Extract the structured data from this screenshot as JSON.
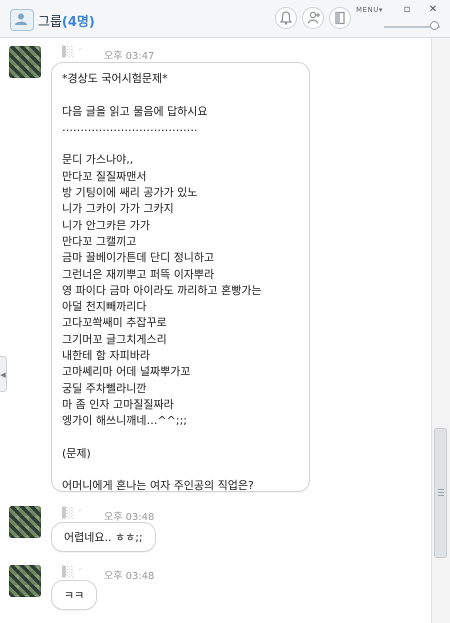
{
  "header": {
    "title": "그룹",
    "member_count": "(4명)",
    "menu_label": "MENU▾",
    "minimize_glyph": "▫",
    "close_glyph": "✕",
    "icons": [
      "group-icon",
      "bell-icon",
      "add-person-icon",
      "door-exit-icon"
    ]
  },
  "messages": [
    {
      "sender": "▐░ ’",
      "time": "오후 03:47",
      "lines": [
        "*경상도 국어시험문제*",
        "",
        "다음 글을 읽고 물음에 답하시요",
        "……………………………….",
        "",
        "문디 가스나야,,",
        "만다꼬 질질짜맨서",
        "방 기팅이에 쌔리 공가가 있노",
        "니가 그카이 가가 그카지",
        "니가 안그카믄 가가",
        "만다꼬 그캘끼고",
        "금마 끌베이가튼데 단디 정니하고",
        "그런너은 재끼뿌고 퍼뜩 이자뿌라",
        "영 파이다 금마 아이라도 까리하고 혼빵가는",
        "아덜 천지빼까리다",
        "고다꼬쏵쌔미 추잡꾸로",
        "그기머꼬 글그치게스리",
        "내한테 함 자피바라",
        "고마쎄리마 어데 널짜뿌가꼬",
        "궁딜 주차뻴라니깐",
        "마 좀 인자 고마질질짜라",
        "엥가이 해쓰니깨네…^^;;;",
        "",
        "(문제)",
        "",
        "어머니에게 혼나는 여자 주인공의 직업은?"
      ]
    },
    {
      "sender": "▐░ ’",
      "time": "오후 03:48",
      "text": "어렵네요.. ㅎㅎ;;"
    },
    {
      "sender": "▐░ ’",
      "time": "오후 03:48",
      "text": "ㅋㅋ"
    }
  ],
  "colors": {
    "accent": "#3b87d3",
    "time_text": "#9a9a9a",
    "bubble_border": "#d3d3d3"
  }
}
